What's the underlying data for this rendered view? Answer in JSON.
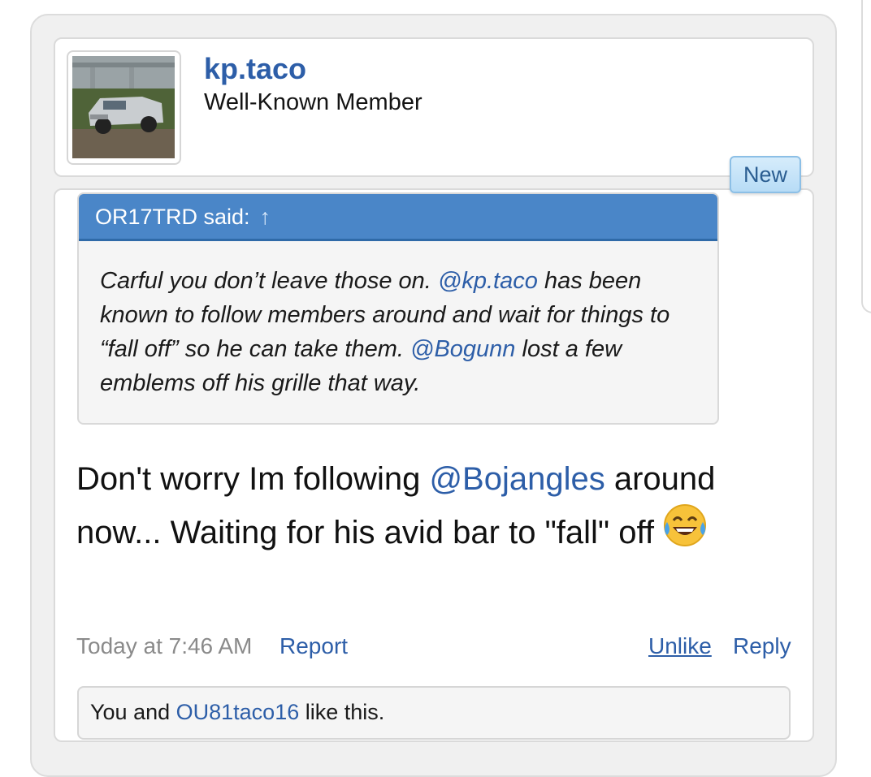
{
  "post": {
    "author": {
      "username": "kp.taco",
      "title": "Well-Known Member"
    },
    "new_badge": "New",
    "quote": {
      "header": "OR17TRD said:",
      "arrow_icon": "↑",
      "text_1": "Carful you don’t leave those on. ",
      "mention_1": "@kp.taco",
      "text_2": " has been known to follow members around and wait for things to “fall off” so he can take them. ",
      "mention_2": "@Bogunn",
      "text_3": " lost a few emblems off his grille that way."
    },
    "message": {
      "text_1": "Don't worry Im following ",
      "mention": "@Bojangles",
      "text_2": " around now... Waiting for his avid bar to \"fall\" off",
      "emoji": "face-with-tears-of-joy"
    },
    "meta": {
      "timestamp": "Today at 7:46 AM",
      "report": "Report",
      "unlike": "Unlike",
      "reply": "Reply"
    },
    "likes": {
      "prefix": "You and ",
      "user": "OU81taco16",
      "suffix": " like this."
    }
  },
  "colors": {
    "link": "#2d5ea8",
    "quote_header": "#4a86c8",
    "badge": "#b7dcf6"
  }
}
